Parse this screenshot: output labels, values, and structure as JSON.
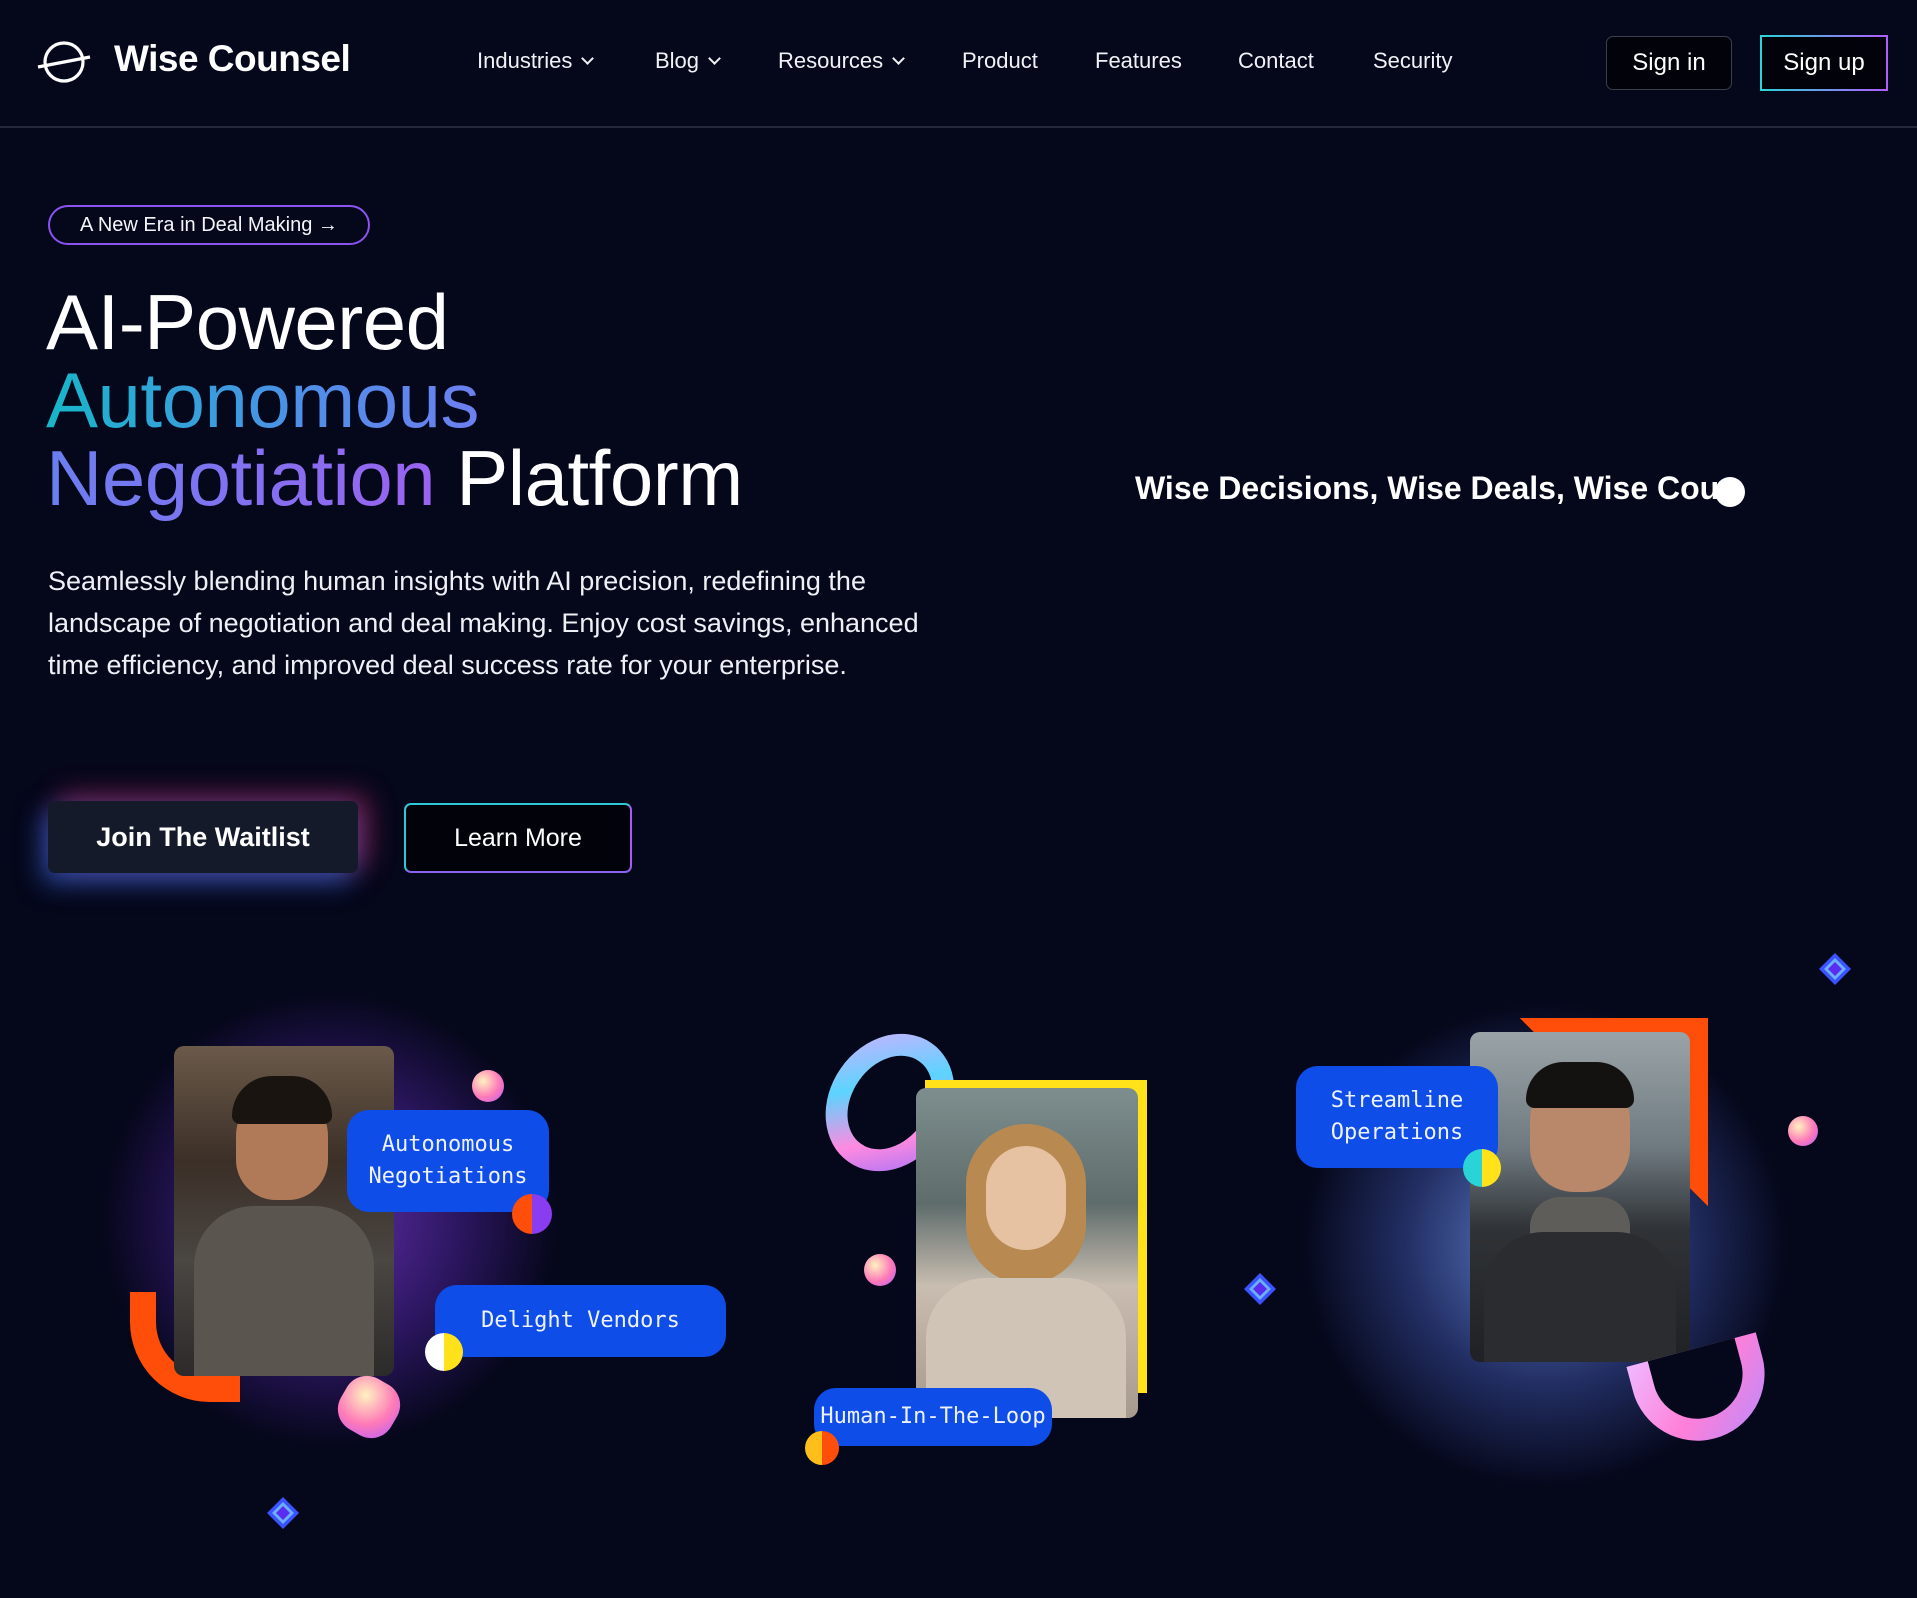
{
  "header": {
    "brand": "Wise Counsel",
    "nav": [
      {
        "label": "Industries",
        "dropdown": true
      },
      {
        "label": "Blog",
        "dropdown": true
      },
      {
        "label": "Resources",
        "dropdown": true
      },
      {
        "label": "Product",
        "dropdown": false
      },
      {
        "label": "Features",
        "dropdown": false
      },
      {
        "label": "Contact",
        "dropdown": false
      },
      {
        "label": "Security",
        "dropdown": false
      }
    ],
    "signin_label": "Sign in",
    "signup_label": "Sign up"
  },
  "hero": {
    "badge": "A New Era in Deal Making →",
    "title_line1": "AI-Powered",
    "title_line2": "Autonomous",
    "title_line3_accent": "Negotiation",
    "title_line3_rest": "Platform",
    "typed_tagline": "Wise Decisions, Wise Deals, Wise Cou",
    "description": "Seamlessly blending human insights with AI precision, redefining the landscape of negotiation and deal making. Enjoy cost savings, enhanced time efficiency, and improved deal success rate for your enterprise.",
    "primary_cta": "Join The Waitlist",
    "secondary_cta": "Learn More"
  },
  "illustration": {
    "tags": {
      "autonomous": "Autonomous Negotiations",
      "delight": "Delight Vendors",
      "hitl": "Human-In-The-Loop",
      "streamline": "Streamline Operations"
    }
  },
  "colors": {
    "background": "#05071a",
    "tag_blue": "#0e4de8",
    "accent_orange": "#ff4d0a",
    "accent_yellow": "#ffe21a",
    "gradient_teal": "#17b6c9",
    "gradient_purple": "#9a63f0"
  }
}
